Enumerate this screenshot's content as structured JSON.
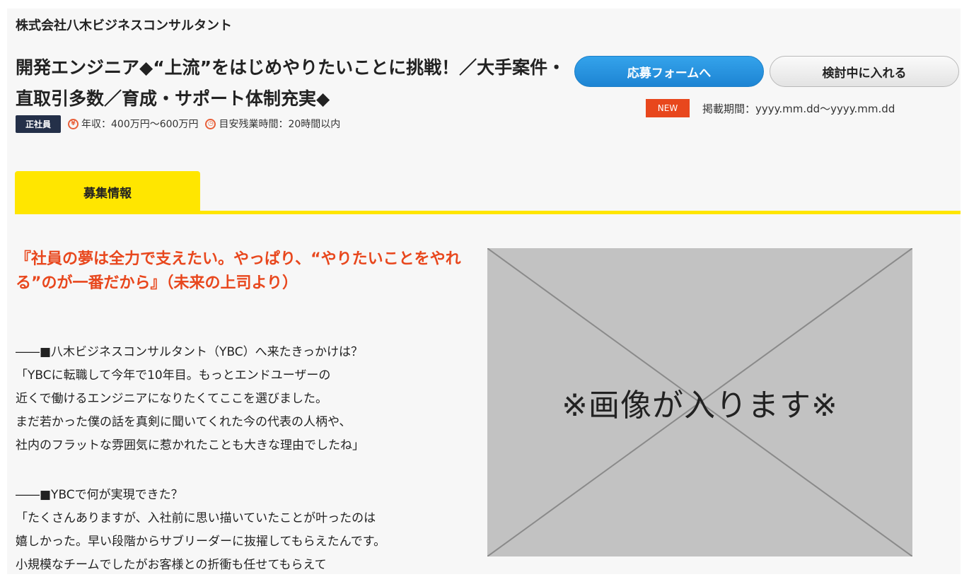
{
  "header": {
    "company_name": "株式会社八木ビジネスコンサルタント",
    "job_title": "開発エンジニア◆“上流”をはじめやりたいことに挑戦！／大手案件・直取引多数／育成・サポート体制充実◆",
    "employment_type": "正社員",
    "salary_icon_glyph": "¥",
    "salary": "年収：400万円〜600万円",
    "overtime_icon_glyph": "◷",
    "overtime": "目安残業時間：20時間以内"
  },
  "actions": {
    "apply_label": "応募フォームへ",
    "save_label": "検討中に入れる",
    "new_badge": "NEW",
    "period": "掲載期間：yyyy.mm.dd〜yyyy.mm.dd"
  },
  "tabs": [
    {
      "label": "募集情報",
      "active": true
    }
  ],
  "article": {
    "headline": "『社員の夢は全力で支えたい。やっぱり、“やりたいことをやれる”のが一番だから』（未来の上司より）",
    "paragraphs": [
      [
        "――■八木ビジネスコンサルタント（YBC）へ来たきっかけは？",
        "「YBCに転職して今年で10年目。もっとエンドユーザーの",
        "近くで働けるエンジニアになりたくてここを選びました。",
        "まだ若かった僕の話を真剣に聞いてくれた今の代表の人柄や、",
        "社内のフラットな雰囲気に惹かれたことも大きな理由でしたね」"
      ],
      [
        "――■YBCで何が実現できた？",
        "「たくさんありますが、入社前に思い描いていたことが叶ったのは",
        "嬉しかった。早い段階からサブリーダーに抜擢してもらえたんです。",
        "小規模なチームでしたがお客様との折衝も任せてもらえて"
      ]
    ],
    "image_placeholder": "※画像が入ります※"
  },
  "colors": {
    "accent_yellow": "#ffe600",
    "headline_orange": "#e8471d",
    "apply_blue": "#1d84d3",
    "badge_navy": "#243049"
  }
}
